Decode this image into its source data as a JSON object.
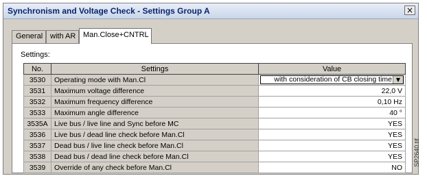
{
  "window": {
    "title": "Synchronism and Voltage Check - Settings Group A",
    "close_label": "×"
  },
  "tabs": [
    {
      "label": "General"
    },
    {
      "label": "with AR"
    },
    {
      "label": "Man.Close+CNTRL"
    }
  ],
  "settings_label": "Settings:",
  "table": {
    "headers": {
      "no": "No.",
      "settings": "Settings",
      "value": "Value"
    },
    "rows": [
      {
        "no": "3530",
        "setting": "Operating mode with Man.Cl",
        "value": "with consideration of CB closing time"
      },
      {
        "no": "3531",
        "setting": "Maximum voltage difference",
        "value": "22,0 V"
      },
      {
        "no": "3532",
        "setting": "Maximum frequency difference",
        "value": "0,10 Hz"
      },
      {
        "no": "3533",
        "setting": "Maximum angle difference",
        "value": "40 °"
      },
      {
        "no": "3535A",
        "setting": "Live bus / live line and Sync before MC",
        "value": "YES"
      },
      {
        "no": "3536",
        "setting": "Live bus / dead line check before Man.Cl",
        "value": "YES"
      },
      {
        "no": "3537",
        "setting": "Dead bus / live line check before Man.Cl",
        "value": "YES"
      },
      {
        "no": "3538",
        "setting": "Dead bus / dead line check before Man.Cl",
        "value": "YES"
      },
      {
        "no": "3539",
        "setting": "Override of any check before Man.Cl",
        "value": "NO"
      }
    ]
  },
  "dropdown_icon": "chevron-down-icon",
  "side_reference": "SP2640.tif"
}
